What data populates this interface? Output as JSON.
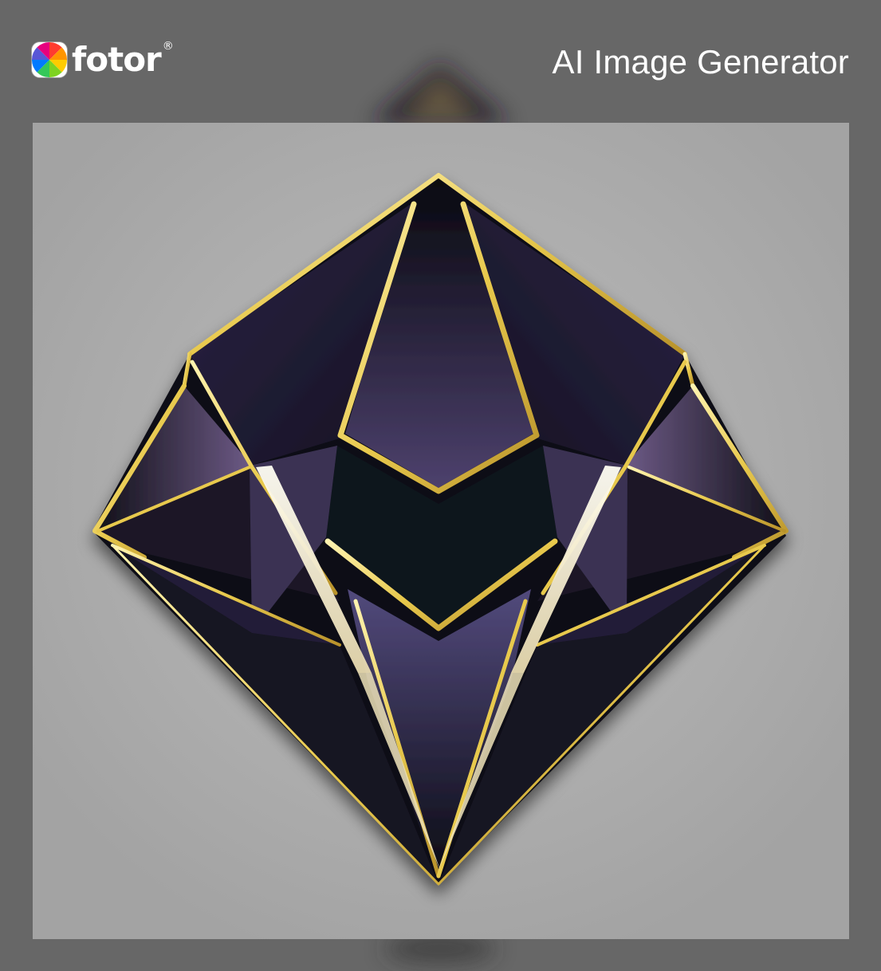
{
  "brand": {
    "name": "fotor",
    "registered_mark": "®",
    "icon": "fotor-rainbow-aperture-icon"
  },
  "header": {
    "title": "AI Image Generator"
  },
  "artwork": {
    "subject": "geometric-diamond-logo",
    "colors": {
      "background_gray": "#b4b4b4",
      "frame_gray": "#676767",
      "deep_navy": "#0d0d1a",
      "violet": "#4a3f6a",
      "gold": "#f2d766"
    }
  }
}
